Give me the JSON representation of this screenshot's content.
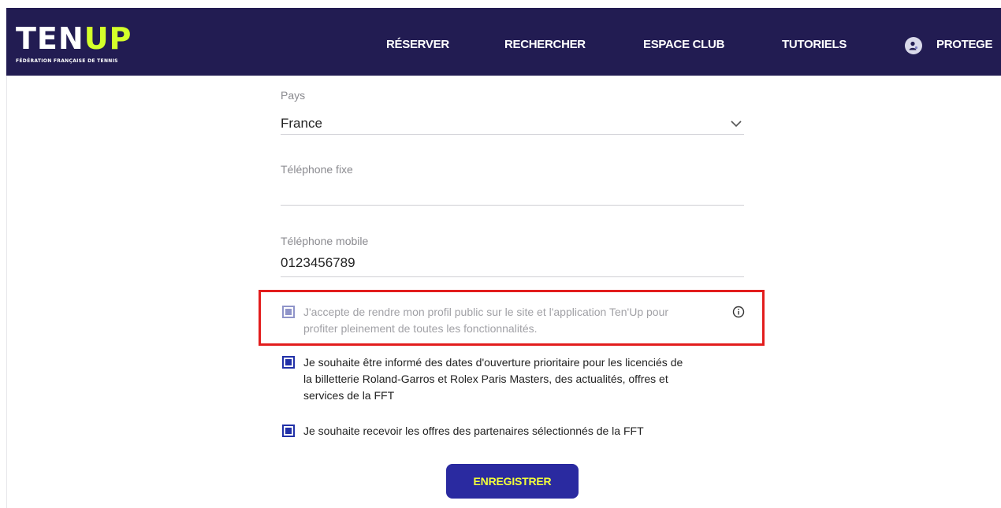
{
  "header": {
    "logo": {
      "main": "TEN",
      "accent": "UP",
      "subtitle": "FÉDÉRATION FRANÇAISE DE TENNIS"
    },
    "nav": [
      {
        "label": "RÉSERVER"
      },
      {
        "label": "RECHERCHER"
      },
      {
        "label": "ESPACE CLUB"
      },
      {
        "label": "TUTORIELS"
      }
    ],
    "user": {
      "label": "PROTEGE",
      "icon": "user-avatar-icon"
    }
  },
  "form": {
    "country": {
      "label": "Pays",
      "value": "France",
      "icon": "chevron-down-icon"
    },
    "landline": {
      "label": "Téléphone fixe",
      "value": ""
    },
    "mobile": {
      "label": "Téléphone mobile",
      "value": "0123456789"
    },
    "consents": [
      {
        "line1": "J'accepte de rendre mon profil public sur le site et l'application Ten'Up pour",
        "line2": "profiter pleinement de toutes les fonctionnalités.",
        "checked": true,
        "info_icon": "info-icon"
      },
      {
        "line1": "Je souhaite être informé des dates d'ouverture prioritaire pour les licenciés de",
        "line2": "la billetterie Roland-Garros et Rolex Paris Masters, des actualités, offres et",
        "line3": "services de la FFT",
        "checked": true
      },
      {
        "line1": "Je souhaite recevoir les offres des partenaires sélectionnés de la FFT",
        "checked": true
      }
    ],
    "submit_label": "ENREGISTRER"
  },
  "colors": {
    "navbar": "#221c52",
    "logo_accent": "#d4ff2a",
    "checkbox": "#2130a8",
    "button": "#2a2aa0",
    "button_text": "#f2ff3a",
    "highlight": "#e21d1d"
  }
}
